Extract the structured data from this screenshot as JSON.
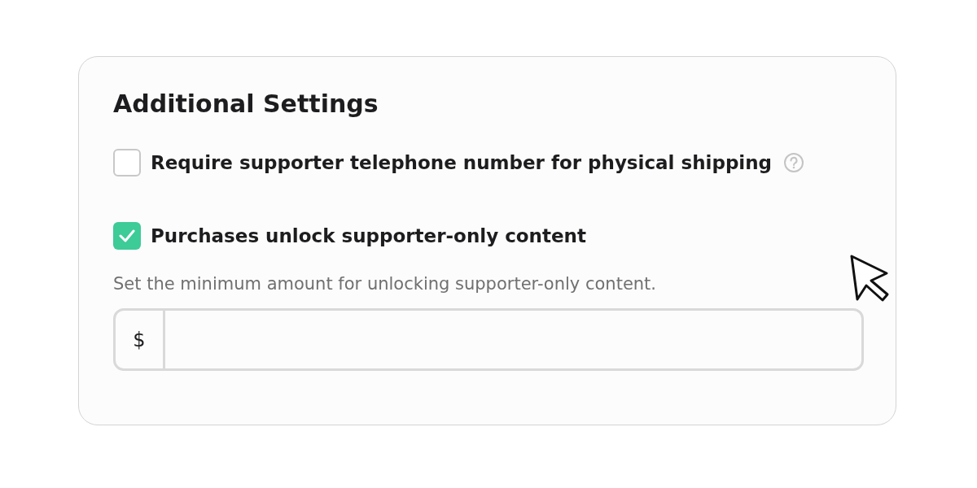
{
  "card": {
    "title": "Additional Settings",
    "options": [
      {
        "label": "Require supporter telephone number for physical shipping",
        "checked": false,
        "help": true
      },
      {
        "label": "Purchases unlock supporter-only content",
        "checked": true,
        "help": false
      }
    ],
    "hint": "Set the minimum amount for unlocking supporter-only content.",
    "amount_field": {
      "prefix": "$"
    }
  }
}
